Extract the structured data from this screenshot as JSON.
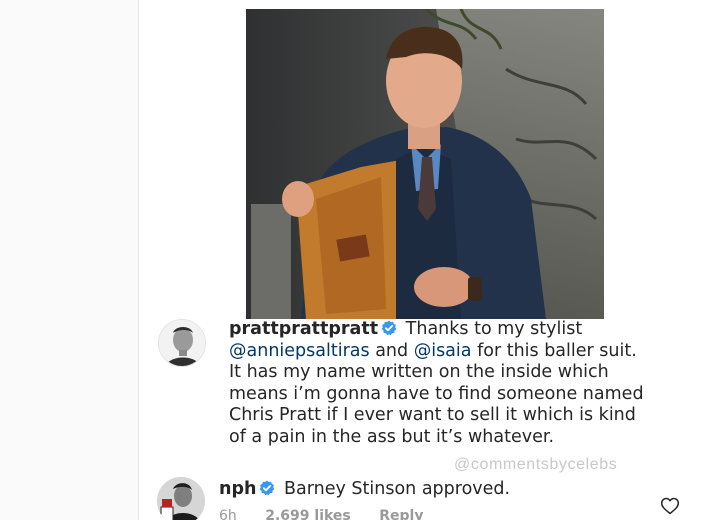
{
  "post": {
    "image_alt": "Man in a blue plaid three-piece suit opening his jacket to show an orange lining",
    "caption": {
      "username": "prattprattpratt",
      "text_parts": [
        "Thanks to my stylist",
        "@anniepsaltiras",
        "and",
        "@isaia",
        "for this baller suit. It has my name written on the inside which means i’m gonna have to find someone named Chris Pratt if I ever want to sell it which is kind of a pain in the ass but it’s whatever."
      ]
    }
  },
  "watermark": "@commentsbycelebs",
  "reply": {
    "username": "nph",
    "text": "Barney Stinson approved.",
    "time": "6h",
    "likes": "2,699 likes",
    "reply_label": "Reply"
  },
  "colors": {
    "verified": "#3897f0",
    "mention": "#00376b",
    "meta": "#999999"
  },
  "icons": {
    "verified": "verified-badge-icon",
    "like": "heart-outline-icon"
  }
}
